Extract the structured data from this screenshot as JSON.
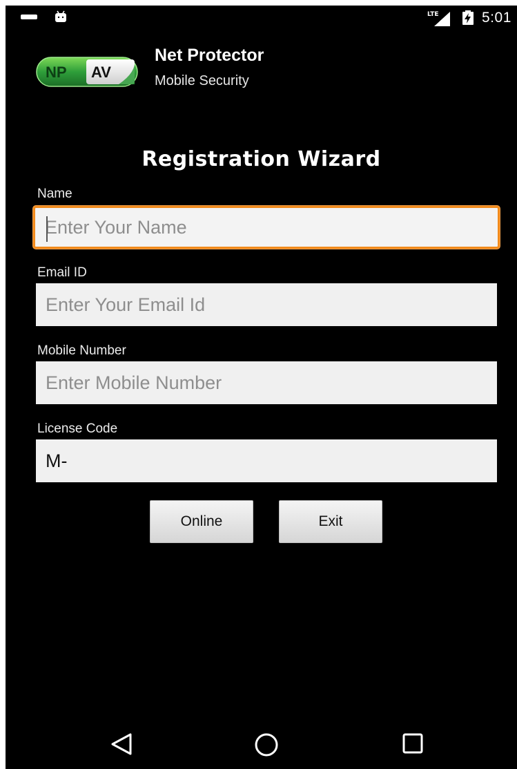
{
  "status_bar": {
    "time": "5:01",
    "network_label": "LTE",
    "icons": [
      "minus-icon",
      "android-icon",
      "lte-signal-icon",
      "battery-charging-icon"
    ]
  },
  "header": {
    "logo": {
      "left_text": "NP",
      "right_text": "AV"
    },
    "app_title": "Net Protector",
    "app_subtitle": "Mobile Security"
  },
  "wizard": {
    "title": "Registration Wizard",
    "fields": [
      {
        "label": "Name",
        "value": "",
        "placeholder": "Enter Your Name",
        "focused": true
      },
      {
        "label": "Email ID",
        "value": "",
        "placeholder": "Enter Your Email Id"
      },
      {
        "label": "Mobile Number",
        "value": "",
        "placeholder": "Enter Mobile Number"
      },
      {
        "label": "License Code",
        "value": "M-",
        "placeholder": ""
      }
    ],
    "buttons": {
      "online": "Online",
      "exit": "Exit"
    }
  },
  "colors": {
    "background": "#000000",
    "focus_border": "#f08a1c",
    "logo_green": "#2e9e3a",
    "input_background": "#f0f0f0"
  },
  "nav_bar": {
    "icons": [
      "back-triangle-icon",
      "home-circle-icon",
      "recents-square-icon"
    ]
  }
}
